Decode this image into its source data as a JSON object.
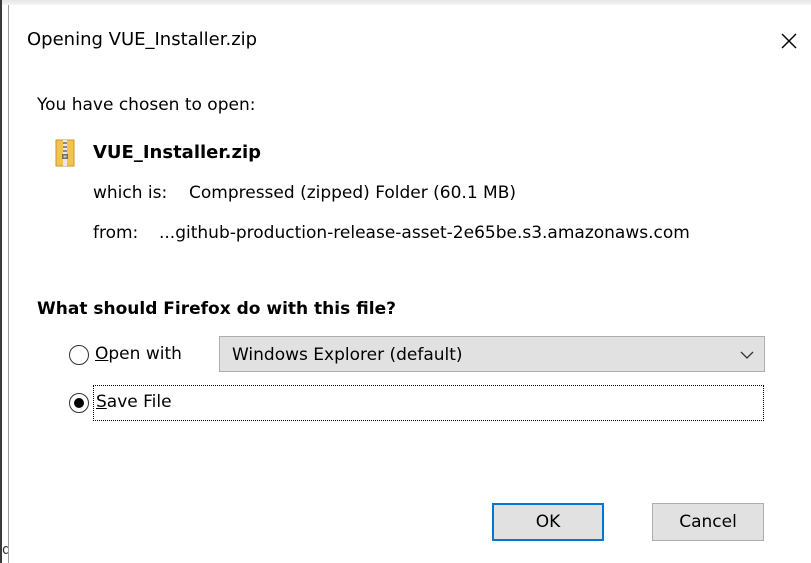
{
  "dialog": {
    "title": "Opening VUE_Installer.zip",
    "prompt": "You have chosen to open:",
    "file": {
      "name": "VUE_Installer.zip",
      "icon": "zip-folder-icon",
      "which_label": "which is:",
      "which_value": "Compressed (zipped) Folder (60.1 MB)",
      "from_label": "from:",
      "from_value": "...github-production-release-asset-2e65be.s3.amazonaws.com"
    },
    "question": "What should Firefox do with this file?",
    "options": {
      "open_with": {
        "label_accel": "O",
        "label_rest": "pen with",
        "selected": false,
        "app": "Windows Explorer (default)"
      },
      "save_file": {
        "label_accel": "S",
        "label_rest": "ave File",
        "selected": true
      }
    },
    "buttons": {
      "ok": "OK",
      "cancel": "Cancel"
    },
    "colors": {
      "focus_border": "#0078d7",
      "button_face": "#e1e1e1"
    }
  }
}
